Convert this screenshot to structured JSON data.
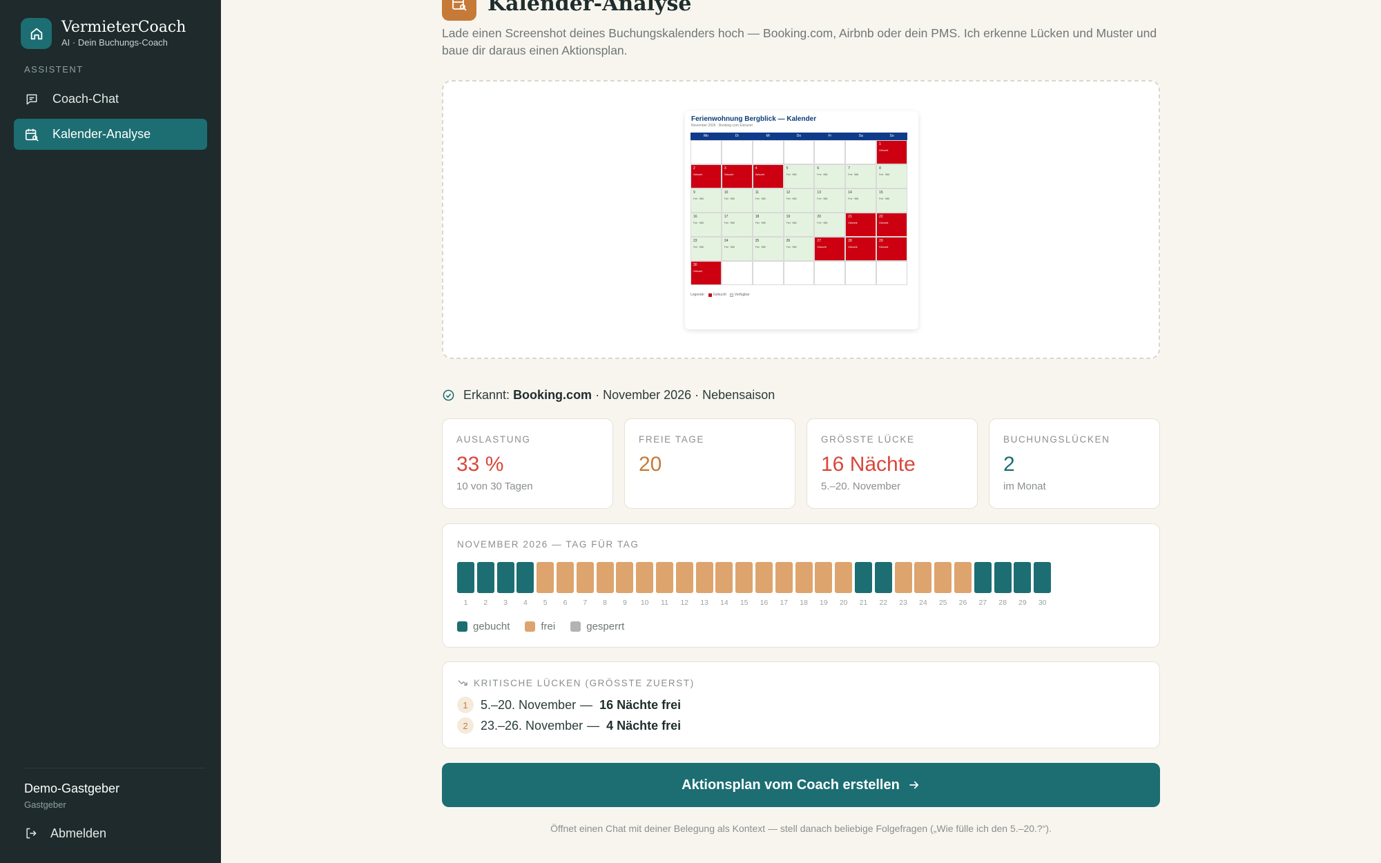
{
  "brand": {
    "name": "VermieterCoach",
    "tagline": "AI · Dein Buchungs-Coach"
  },
  "sidebar": {
    "section_label": "ASSISTENT",
    "items": [
      {
        "label": "Coach-Chat",
        "icon": "chat-icon",
        "active": false
      },
      {
        "label": "Kalender-Analyse",
        "icon": "calendar-search-icon",
        "active": true
      }
    ],
    "user": {
      "name": "Demo-Gastgeber",
      "role": "Gastgeber"
    },
    "logout_label": "Abmelden"
  },
  "page": {
    "title": "Kalender-Analyse",
    "description": "Lade einen Screenshot deines Buchungskalenders hoch — Booking.com, Airbnb oder dein PMS. Ich erkenne Lücken und Muster und baue dir daraus einen Aktionsplan."
  },
  "preview": {
    "title": "Ferienwohnung Bergblick — Kalender",
    "subtitle": "November 2026 · Booking.com Extranet",
    "weekdays": [
      "Mo",
      "Di",
      "Mi",
      "Do",
      "Fr",
      "Sa",
      "So"
    ],
    "booked_label": "Gebucht",
    "free_label": "Frei · €85",
    "legend_label": "Legende:",
    "legend_booked": "Gebucht",
    "legend_free": "Verfügbar"
  },
  "detected": {
    "prefix": "Erkannt:",
    "platform": "Booking.com",
    "rest": "· November 2026 · Nebensaison"
  },
  "stats": [
    {
      "label": "AUSLASTUNG",
      "value": "33 %",
      "sub": "10 von 30 Tagen",
      "color": "#d9463b"
    },
    {
      "label": "FREIE TAGE",
      "value": "20",
      "sub": "",
      "color": "#c67a37"
    },
    {
      "label": "GRÖSSTE LÜCKE",
      "value": "16 Nächte",
      "sub": "5.–20. November",
      "color": "#d9463b"
    },
    {
      "label": "BUCHUNGSLÜCKEN",
      "value": "2",
      "sub": "im Monat",
      "color": "#1c6e72"
    }
  ],
  "timeline": {
    "title": "NOVEMBER 2026 — TAG FÜR TAG",
    "days": [
      {
        "day": "1",
        "status": "booked"
      },
      {
        "day": "2",
        "status": "booked"
      },
      {
        "day": "3",
        "status": "booked"
      },
      {
        "day": "4",
        "status": "booked"
      },
      {
        "day": "5",
        "status": "free"
      },
      {
        "day": "6",
        "status": "free"
      },
      {
        "day": "7",
        "status": "free"
      },
      {
        "day": "8",
        "status": "free"
      },
      {
        "day": "9",
        "status": "free"
      },
      {
        "day": "10",
        "status": "free"
      },
      {
        "day": "11",
        "status": "free"
      },
      {
        "day": "12",
        "status": "free"
      },
      {
        "day": "13",
        "status": "free"
      },
      {
        "day": "14",
        "status": "free"
      },
      {
        "day": "15",
        "status": "free"
      },
      {
        "day": "16",
        "status": "free"
      },
      {
        "day": "17",
        "status": "free"
      },
      {
        "day": "18",
        "status": "free"
      },
      {
        "day": "19",
        "status": "free"
      },
      {
        "day": "20",
        "status": "free"
      },
      {
        "day": "21",
        "status": "booked"
      },
      {
        "day": "22",
        "status": "booked"
      },
      {
        "day": "23",
        "status": "free"
      },
      {
        "day": "24",
        "status": "free"
      },
      {
        "day": "25",
        "status": "free"
      },
      {
        "day": "26",
        "status": "free"
      },
      {
        "day": "27",
        "status": "booked"
      },
      {
        "day": "28",
        "status": "booked"
      },
      {
        "day": "29",
        "status": "booked"
      },
      {
        "day": "30",
        "status": "booked"
      }
    ],
    "colors": {
      "booked": "#1c6e72",
      "free": "#dda46e",
      "blocked": "#b3b3b3"
    },
    "legend": {
      "booked": "gebucht",
      "free": "frei",
      "blocked": "gesperrt"
    }
  },
  "gaps": {
    "title": "KRITISCHE LÜCKEN (GRÖSSTE ZUERST)",
    "items": [
      {
        "rank": "1",
        "range": "5.–20. November",
        "nights": "16 Nächte frei"
      },
      {
        "rank": "2",
        "range": "23.–26. November",
        "nights": "4 Nächte frei"
      }
    ]
  },
  "cta": {
    "label": "Aktionsplan vom Coach erstellen",
    "note": "Öffnet einen Chat mit deiner Belegung als Kontext — stell danach beliebige Folgefragen („Wie fülle ich den 5.–20.?“)."
  }
}
